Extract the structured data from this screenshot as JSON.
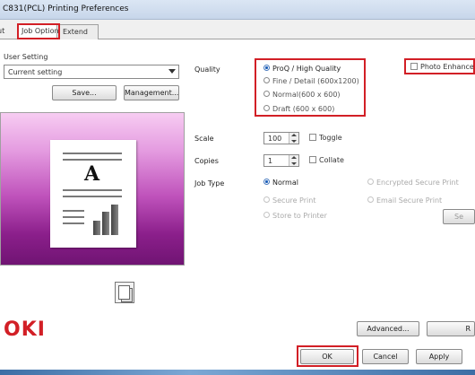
{
  "window": {
    "title": "C831(PCL) Printing Preferences"
  },
  "tabs": {
    "cut_label": "ut",
    "active_label": "Job Options",
    "extend_label": "Extend"
  },
  "user_setting": {
    "label": "User Setting",
    "value": "Current setting",
    "save_label": "Save...",
    "management_label": "Management..."
  },
  "quality": {
    "label": "Quality",
    "options": [
      {
        "label": "ProQ / High Quality",
        "selected": true
      },
      {
        "label": "Fine / Detail (600x1200)",
        "selected": false
      },
      {
        "label": "Normal(600 x 600)",
        "selected": false
      },
      {
        "label": "Draft (600 x 600)",
        "selected": false
      }
    ],
    "photo_enhance_label": "Photo Enhance"
  },
  "scale": {
    "label": "Scale",
    "value": "100",
    "toggle_label": "Toggle"
  },
  "copies": {
    "label": "Copies",
    "value": "1",
    "collate_label": "Collate"
  },
  "job_type": {
    "label": "Job Type",
    "options": [
      {
        "label": "Normal",
        "selected": true
      },
      {
        "label": "Encrypted Secure Print",
        "selected": false
      },
      {
        "label": "Secure Print",
        "selected": false
      },
      {
        "label": "Email Secure Print",
        "selected": false
      },
      {
        "label": "Store to Printer",
        "selected": false
      }
    ],
    "settings_button": "Se"
  },
  "brand": {
    "logo": "OKI"
  },
  "buttons": {
    "advanced": "Advanced...",
    "right_cut": "R",
    "ok": "OK",
    "cancel": "Cancel",
    "apply": "Apply"
  },
  "colors": {
    "highlight": "#d21f26",
    "brand": "#d21f26"
  }
}
